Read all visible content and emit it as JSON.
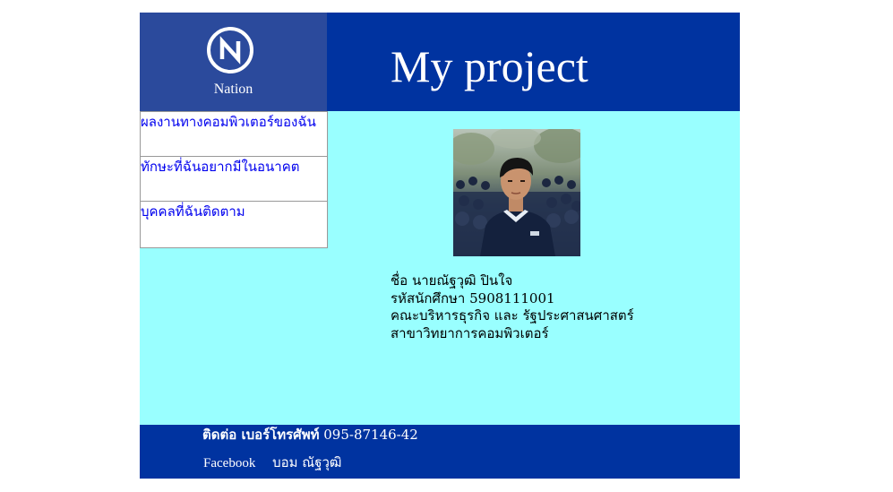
{
  "header": {
    "logo_text": "Nation",
    "logo_letter": "N",
    "title": "My project"
  },
  "nav": {
    "items": [
      {
        "label": "ผลงานทางคอมพิวเตอร์ของฉัน"
      },
      {
        "label": "ทักษะที่ฉันอยากมีในอนาคต"
      },
      {
        "label": "บุคคลที่ฉันติดตาม"
      }
    ]
  },
  "profile": {
    "name_line": "ชื่อ นายณัฐวุฒิ ปินใจ",
    "student_id_line": "รหัสนักศึกษา 5908111001",
    "faculty_line": "คณะบริหารธุรกิจ และ รัฐประศาสนศาสตร์",
    "major_line": "สาขาวิทยาการคอมพิวเตอร์"
  },
  "footer": {
    "contact_label": "ติดต่อ เบอร์โทรศัพท์",
    "phone": "095-87146-42",
    "facebook_label": "Facebook",
    "facebook_name": "บอม ณัฐวุฒิ"
  },
  "colors": {
    "header_bg": "#0033a0",
    "logo_bg": "#2b4a9c",
    "body_bg": "#99ffff",
    "link": "#0000ee"
  }
}
